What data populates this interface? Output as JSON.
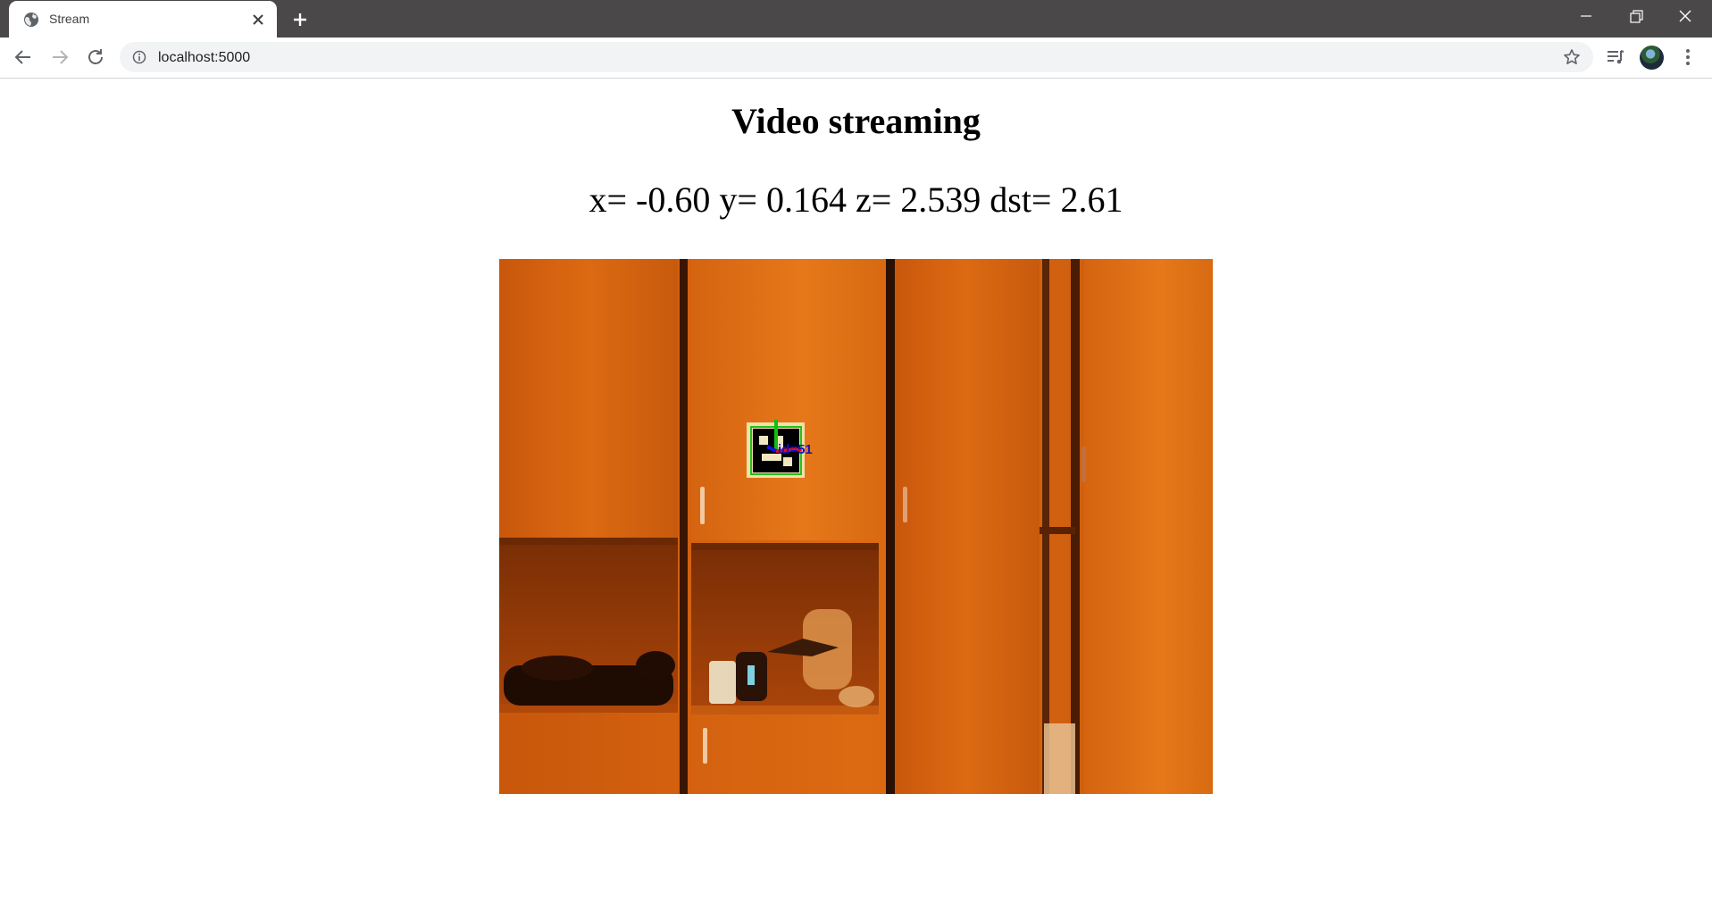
{
  "browser": {
    "tab_title": "Stream",
    "url": "localhost:5000",
    "icons": [
      "globe-icon",
      "close-icon",
      "plus-icon",
      "minimize-icon",
      "restore-icon",
      "close-window-icon",
      "back-icon",
      "forward-icon",
      "reload-icon",
      "info-icon",
      "star-icon",
      "media-control-icon",
      "avatar",
      "more-vert-icon"
    ]
  },
  "page": {
    "title": "Video streaming",
    "coords": {
      "x_label": "x=",
      "x_value": "-0.60",
      "y_label": "y=",
      "y_value": "0.164",
      "z_label": "z=",
      "z_value": "2.539",
      "dst_label": "dst=",
      "dst_value": "2.61"
    },
    "video": {
      "marker_id": "id=51"
    }
  },
  "colors": {
    "chrome_dark": "#4a4849",
    "omnibox": "#f1f3f4",
    "wood": "#d1600e",
    "axis_x": "#e01010",
    "axis_y": "#10c010",
    "axis_z": "#1010e0"
  }
}
